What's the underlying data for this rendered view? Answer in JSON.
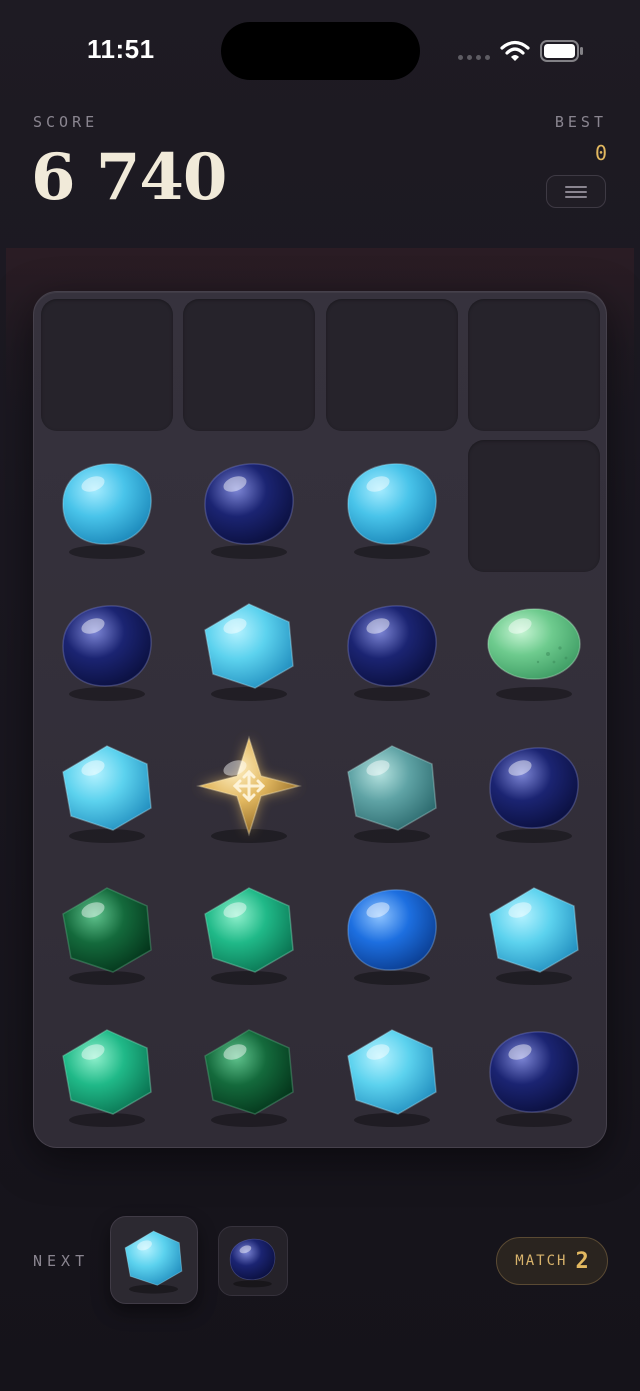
{
  "status_bar": {
    "time": "11:51"
  },
  "score": {
    "label": "SCORE",
    "value": "6 740"
  },
  "best": {
    "label": "BEST",
    "value": "0"
  },
  "menu": {
    "icon": "hamburger-menu-icon"
  },
  "board": {
    "columns": 4,
    "rows": 6,
    "cells": [
      [
        "empty",
        "empty",
        "empty",
        "empty"
      ],
      [
        "sky-blue-blob",
        "navy-blob",
        "sky-blue-blob",
        "empty"
      ],
      [
        "navy-blob",
        "sky-blue-hexagon",
        "navy-blob",
        "mint-green-egg"
      ],
      [
        "sky-blue-hexagon",
        "gold-star-wildcard",
        "teal-hexagon",
        "navy-blob"
      ],
      [
        "dark-green-hexagon",
        "emerald-hexagon",
        "cobalt-blue-blob",
        "sky-blue-hexagon"
      ],
      [
        "emerald-hexagon",
        "dark-green-hexagon",
        "sky-blue-hexagon",
        "navy-blob"
      ]
    ],
    "wildcard_icon": "move-arrows-icon"
  },
  "next": {
    "label": "NEXT",
    "pieces": [
      "sky-blue-hexagon",
      "navy-blob"
    ]
  },
  "match": {
    "label": "MATCH",
    "value": "2"
  },
  "colors": {
    "sky_blue": "#49c4ea",
    "navy": "#1b2472",
    "teal": "#5fa3a5",
    "mint_green": "#6ecb8e",
    "dark_green": "#146a3c",
    "emerald": "#20b988",
    "cobalt": "#1d6fe0",
    "gold": "#e2b860"
  }
}
